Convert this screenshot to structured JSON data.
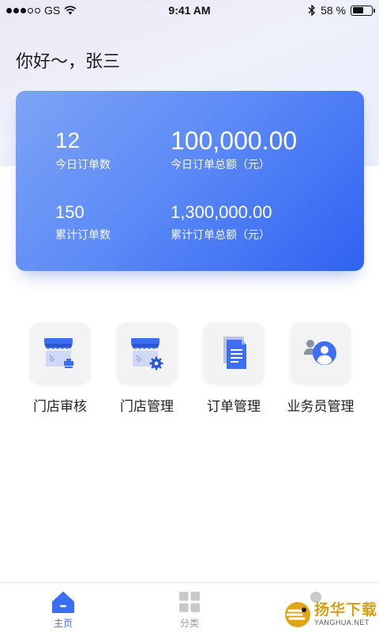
{
  "status_bar": {
    "carrier": "GS",
    "time": "9:41 AM",
    "battery": "58 %",
    "battery_level": 0.58
  },
  "greeting": "你好～，张三",
  "stats": {
    "today_orders": {
      "value": "12",
      "label": "今日订单数"
    },
    "today_amount": {
      "value": "100,000.00",
      "label": "今日订单总额（元）"
    },
    "total_orders": {
      "value": "150",
      "label": "累计订单数"
    },
    "total_amount": {
      "value": "1,300,000.00",
      "label": "累计订单总额（元）"
    }
  },
  "menu": [
    {
      "label": "门店审核",
      "icon": "store-audit-icon"
    },
    {
      "label": "门店管理",
      "icon": "store-manage-icon"
    },
    {
      "label": "订单管理",
      "icon": "order-document-icon"
    },
    {
      "label": "业务员管理",
      "icon": "salesperson-icon"
    }
  ],
  "tabs": [
    {
      "label": "主页",
      "icon": "home-icon",
      "active": true
    },
    {
      "label": "分类",
      "icon": "category-grid-icon",
      "active": false
    },
    {
      "label": "",
      "icon": "profile-icon",
      "active": false
    }
  ],
  "watermark": {
    "cn": "扬华下载",
    "en": "YANGHUA.NET"
  },
  "colors": {
    "accent": "#3a6ef4",
    "card_start": "#7da4f6",
    "card_end": "#2f62f2",
    "watermark": "#d9a015"
  }
}
